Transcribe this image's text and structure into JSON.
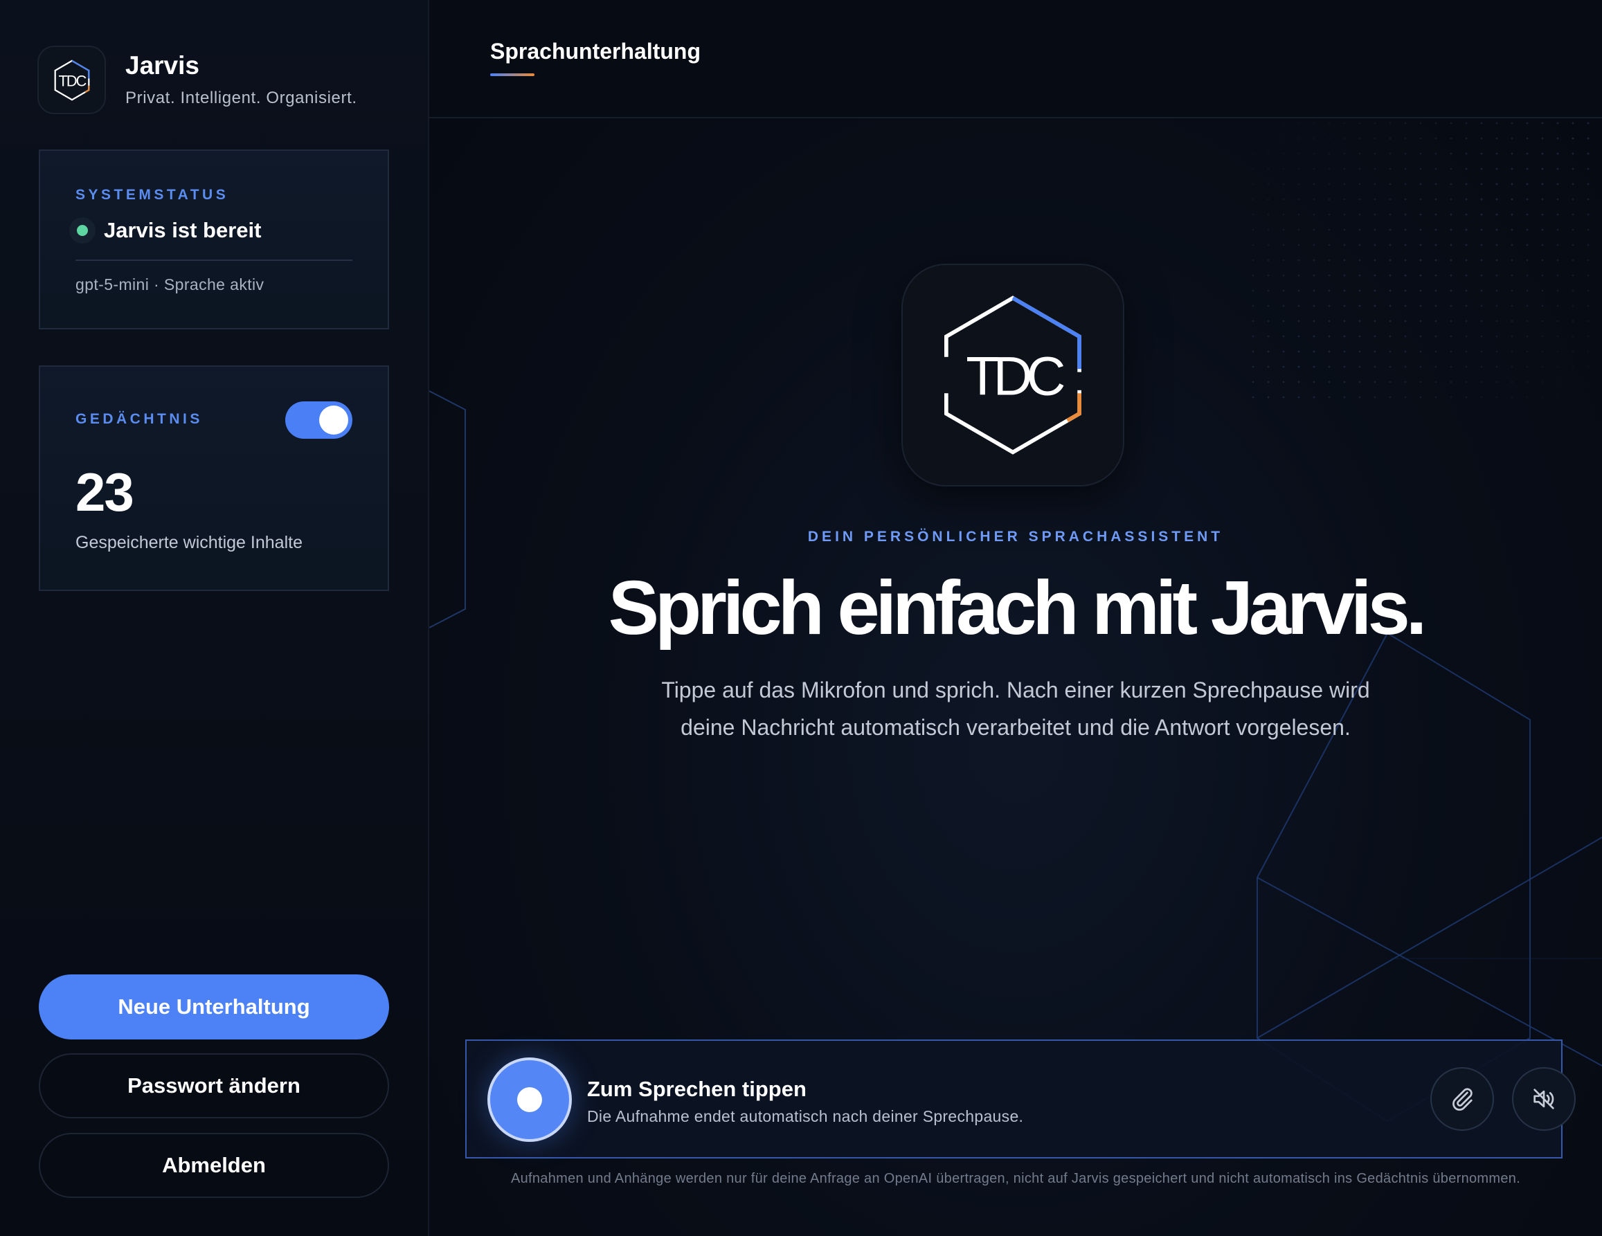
{
  "brand": {
    "name": "Jarvis",
    "tagline": "Privat. Intelligent. Organisiert.",
    "logo_text": "TDC"
  },
  "system_status": {
    "label": "SYSTEMSTATUS",
    "title": "Jarvis ist bereit",
    "meta": "gpt-5-mini · Sprache aktiv",
    "status_color": "#5ed6a2"
  },
  "memory": {
    "label": "GEDÄCHTNIS",
    "enabled": true,
    "count": "23",
    "caption": "Gespeicherte wichtige Inhalte"
  },
  "actions": {
    "new_conversation": "Neue Unterhaltung",
    "change_password": "Passwort ändern",
    "logout": "Abmelden"
  },
  "header": {
    "active_tab": "Sprachunterhaltung"
  },
  "hero": {
    "logo_text": "TDC",
    "eyebrow": "DEIN PERSÖNLICHER SPRACHASSISTENT",
    "title": "Sprich einfach mit Jarvis.",
    "text": "Tippe auf das Mikrofon und sprich. Nach einer kurzen Sprechpause wird deine Nachricht automatisch verarbeitet und die Antwort vorgelesen."
  },
  "voice": {
    "title": "Zum Sprechen tippen",
    "subtitle": "Die Aufnahme endet automatisch nach deiner Sprechpause.",
    "attach_icon": "paperclip-icon",
    "speaker_icon": "speaker-muted-icon"
  },
  "disclaimer": "Aufnahmen und Anhänge werden nur für deine Anfrage an OpenAI übertragen, nicht auf Jarvis gespeichert und nicht automatisch ins Gedächtnis übernommen.",
  "colors": {
    "accent": "#4c82f5",
    "accent_orange": "#e98b3a",
    "label_blue": "#5b8cf0",
    "background": "#050911"
  }
}
